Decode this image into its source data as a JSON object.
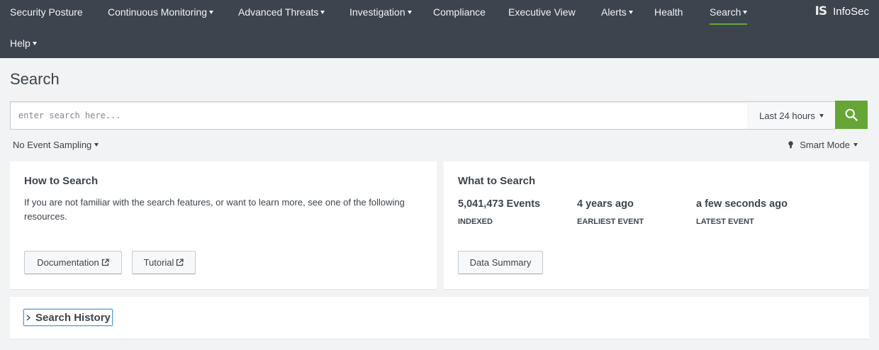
{
  "nav": {
    "items": [
      {
        "label": "Security Posture",
        "caret": false
      },
      {
        "label": "Continuous Monitoring",
        "caret": true
      },
      {
        "label": "Advanced Threats",
        "caret": true
      },
      {
        "label": "Investigation",
        "caret": true
      },
      {
        "label": "Compliance",
        "caret": false
      },
      {
        "label": "Executive View",
        "caret": false
      },
      {
        "label": "Alerts",
        "caret": true
      },
      {
        "label": "Health",
        "caret": false
      },
      {
        "label": "Search",
        "caret": true,
        "active": true
      },
      {
        "label": "Help",
        "caret": true
      }
    ],
    "logo_mark": "IS",
    "logo_text": "InfoSec"
  },
  "page": {
    "title": "Search"
  },
  "search": {
    "placeholder": "enter search here...",
    "time_range": "Last 24 hours",
    "sampling": "No Event Sampling",
    "mode": "Smart Mode"
  },
  "how_to": {
    "title": "How to Search",
    "text": "If you are not familiar with the search features, or want to learn more, see one of the following resources.",
    "documentation_label": "Documentation",
    "tutorial_label": "Tutorial"
  },
  "what_to": {
    "title": "What to Search",
    "stats": [
      {
        "value": "5,041,473 Events",
        "label": "INDEXED"
      },
      {
        "value": "4 years ago",
        "label": "EARLIEST EVENT"
      },
      {
        "value": "a few seconds ago",
        "label": "LATEST EVENT"
      }
    ],
    "data_summary_label": "Data Summary"
  },
  "history": {
    "label": "Search History"
  },
  "colors": {
    "nav_bg": "#3c444d",
    "accent_green": "#65a637",
    "page_bg": "#f2f3f4",
    "focus_blue": "#5f9cd6"
  }
}
